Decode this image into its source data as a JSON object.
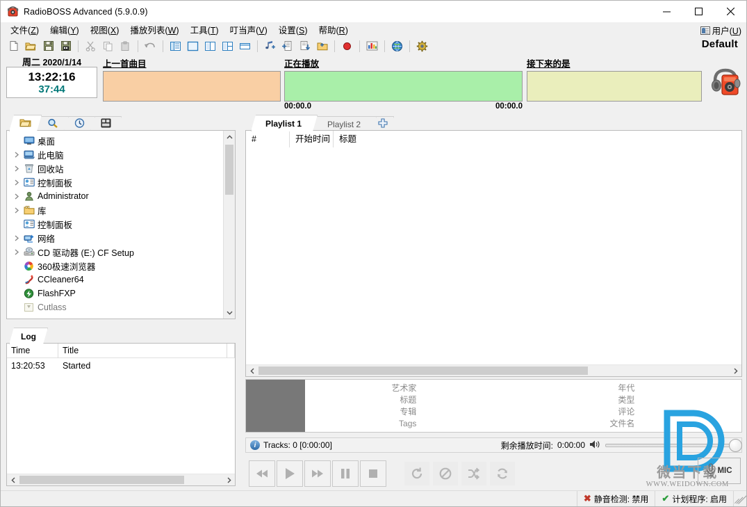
{
  "window": {
    "title": "RadioBOSS Advanced (5.9.0.9)",
    "app_icon": "radio-icon",
    "minimize": "—",
    "maximize": "□",
    "close": "✕"
  },
  "menubar": {
    "items": [
      {
        "name": "file",
        "label": "文件(Z)",
        "text": "文件",
        "key": "Z"
      },
      {
        "name": "edit",
        "label": "编辑(Y)",
        "text": "编辑",
        "key": "Y"
      },
      {
        "name": "view",
        "label": "视图(X)",
        "text": "视图",
        "key": "X"
      },
      {
        "name": "playlist",
        "label": "播放列表(W)",
        "text": "播放列表",
        "key": "W"
      },
      {
        "name": "tools",
        "label": "工具(T)",
        "text": "工具",
        "key": "T"
      },
      {
        "name": "jingles",
        "label": "叮当声(V)",
        "text": "叮当声",
        "key": "V"
      },
      {
        "name": "settings",
        "label": "设置(S)",
        "text": "设置",
        "key": "S"
      },
      {
        "name": "help",
        "label": "帮助(R)",
        "text": "帮助",
        "key": "R"
      }
    ],
    "user": {
      "text": "用户",
      "key": "U",
      "label": "用户(U)",
      "icon": "user-card-icon"
    }
  },
  "toolbar": {
    "buttons": [
      "new-file-icon",
      "open-folder-icon",
      "save-icon",
      "save-as-icon",
      "cut-icon",
      "copy-icon",
      "paste-icon",
      "undo-icon",
      "layout-left-icon",
      "layout-single-icon",
      "layout-columns-icon",
      "layout-grid-icon",
      "layout-bottom-icon",
      "add-track-icon",
      "add-playlist-icon",
      "insert-track-icon",
      "new-folder-icon",
      "record-icon",
      "statistics-icon",
      "internet-icon",
      "settings-gear-icon"
    ],
    "profile_label": "Default"
  },
  "infobar": {
    "clock": {
      "weekday": "周二",
      "date": "2020/1/14",
      "time": "13:22:16",
      "countdown": "37:44"
    },
    "previous": {
      "label": "上一首曲目",
      "value": "",
      "color": "#f9cfa4"
    },
    "now_playing": {
      "label": "正在播放",
      "value": "",
      "color": "#a9efa9",
      "elapsed": "00:00.0",
      "remaining": "00:00.0"
    },
    "next": {
      "label": "接下来的是",
      "value": "",
      "color": "#eaeebc"
    },
    "logo_icon": "radio-headphones-icon"
  },
  "browser": {
    "tabs": [
      {
        "name": "files",
        "icon": "folder-icon",
        "active": true
      },
      {
        "name": "search",
        "icon": "magnifier-icon",
        "active": false
      },
      {
        "name": "history",
        "icon": "clock-icon",
        "active": false
      },
      {
        "name": "cartwall",
        "icon": "cartwall-icon",
        "active": false
      }
    ],
    "tree": [
      {
        "label": "桌面",
        "icon": "desktop-icon",
        "expandable": false,
        "indent": 1
      },
      {
        "label": "此电脑",
        "icon": "computer-icon",
        "expandable": true,
        "indent": 0
      },
      {
        "label": "回收站",
        "icon": "recycle-bin-icon",
        "expandable": true,
        "indent": 0
      },
      {
        "label": "控制面板",
        "icon": "control-panel-icon",
        "expandable": true,
        "indent": 0
      },
      {
        "label": "Administrator",
        "icon": "user-folder-icon",
        "expandable": true,
        "indent": 0
      },
      {
        "label": "库",
        "icon": "library-icon",
        "expandable": true,
        "indent": 0
      },
      {
        "label": "控制面板",
        "icon": "control-panel-icon",
        "expandable": false,
        "indent": 1
      },
      {
        "label": "网络",
        "icon": "network-icon",
        "expandable": true,
        "indent": 0
      },
      {
        "label": "CD 驱动器 (E:) CF Setup",
        "icon": "cd-drive-icon",
        "expandable": true,
        "indent": 0
      },
      {
        "label": "360极速浏览器",
        "icon": "browser360-icon",
        "expandable": false,
        "indent": 1
      },
      {
        "label": "CCleaner64",
        "icon": "ccleaner-icon",
        "expandable": false,
        "indent": 1
      },
      {
        "label": "FlashFXP",
        "icon": "flashfxp-icon",
        "expandable": false,
        "indent": 1
      },
      {
        "label": "Cutlass",
        "icon": "app-icon",
        "expandable": false,
        "indent": 1
      }
    ]
  },
  "log": {
    "tab_label": "Log",
    "columns": [
      "Time",
      "Title",
      ""
    ],
    "rows": [
      {
        "time": "13:20:53",
        "title": "Started",
        "extra": ""
      }
    ]
  },
  "playlist": {
    "tabs": [
      {
        "name": "playlist-1",
        "label": "Playlist 1",
        "active": true
      },
      {
        "name": "playlist-2",
        "label": "Playlist 2",
        "active": false
      }
    ],
    "add_tab_icon": "add-tab-icon",
    "columns": [
      "#",
      "开始时间",
      "标题"
    ],
    "rows": []
  },
  "metadata": {
    "left": [
      {
        "key": "艺术家",
        "value": ""
      },
      {
        "key": "标题",
        "value": ""
      },
      {
        "key": "专辑",
        "value": ""
      },
      {
        "key": "Tags",
        "value": ""
      }
    ],
    "right": [
      {
        "key": "年代",
        "value": ""
      },
      {
        "key": "类型",
        "value": ""
      },
      {
        "key": "评论",
        "value": ""
      },
      {
        "key": "文件名",
        "value": ""
      }
    ]
  },
  "status_strip": {
    "info_icon": "info-icon",
    "tracks_text": "Tracks: 0 [0:00:00]",
    "remaining_label": "剩余播放时间:",
    "remaining_value": "0:00:00",
    "volume_icon": "speaker-icon",
    "volume_percent": 100
  },
  "transport": {
    "buttons": [
      {
        "name": "previous-button",
        "icon": "rewind-icon"
      },
      {
        "name": "play-button",
        "icon": "play-icon"
      },
      {
        "name": "next-button",
        "icon": "fast-forward-icon"
      },
      {
        "name": "pause-button",
        "icon": "pause-icon"
      },
      {
        "name": "stop-button",
        "icon": "stop-icon"
      }
    ],
    "toggles": [
      {
        "name": "repeat-one-button",
        "icon": "loop-icon"
      },
      {
        "name": "disable-button",
        "icon": "no-entry-icon"
      },
      {
        "name": "shuffle-button",
        "icon": "shuffle-icon"
      },
      {
        "name": "repeat-all-button",
        "icon": "refresh-icon"
      }
    ]
  },
  "watermark": {
    "cn": "微当下载",
    "en": "WWW.WEIDOWN.COM",
    "logo": "D"
  },
  "mic": {
    "label": "MIC",
    "icon": "microphone-icon"
  },
  "statusbar": {
    "silence": {
      "icon": "cross-icon",
      "label": "静音检测: 禁用"
    },
    "scheduler": {
      "icon": "check-icon",
      "label": "计划程序: 启用"
    }
  },
  "colors": {
    "prev_slot": "#f9cfa4",
    "now_slot": "#a9efa9",
    "next_slot": "#eaeebc",
    "countdown": "#007878",
    "accent_blue": "#29a3e0"
  }
}
